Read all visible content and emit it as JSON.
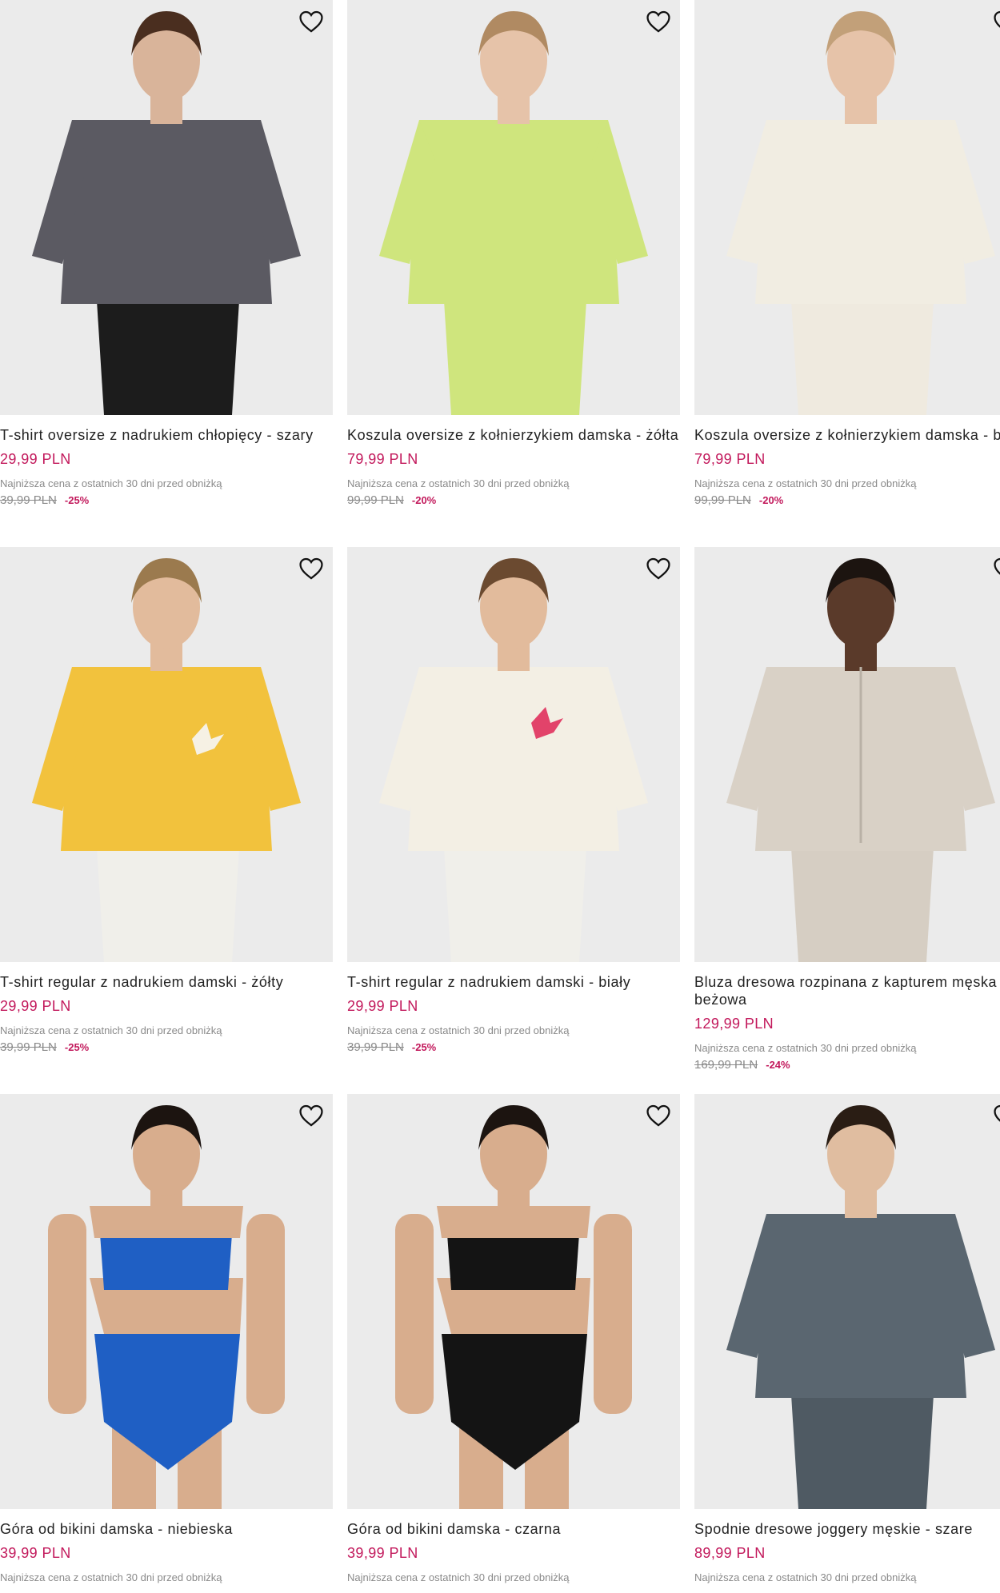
{
  "accent_price_color": "#c2185b",
  "icons": {
    "wishlist": "heart-outline-icon"
  },
  "products": [
    {
      "title": "T-shirt oversize z nadrukiem chłopięcy - szary",
      "price": "29,99 PLN",
      "lowest_label": "Najniższa cena z ostatnich 30 dni przed obniżką",
      "old_price": "39,99 PLN",
      "discount": "-25%",
      "image_colors": {
        "top": "#5b5a62",
        "bottom": "#1c1c1c",
        "skin": "#d9b49a",
        "hair": "#4a2e1f"
      }
    },
    {
      "title": "Koszula oversize z kołnierzykiem damska - żółta",
      "price": "79,99 PLN",
      "lowest_label": "Najniższa cena z ostatnich 30 dni przed obniżką",
      "old_price": "99,99 PLN",
      "discount": "-20%",
      "image_colors": {
        "top": "#cfe57d",
        "bottom": "#cfe57d",
        "skin": "#e6c3a9",
        "hair": "#b08a62"
      }
    },
    {
      "title": "Koszula oversize z kołnierzykiem damska - biała",
      "price": "79,99 PLN",
      "lowest_label": "Najniższa cena z ostatnich 30 dni przed obniżką",
      "old_price": "99,99 PLN",
      "discount": "-20%",
      "image_colors": {
        "top": "#f1ede2",
        "bottom": "#efeadf",
        "skin": "#e6c3a9",
        "hair": "#c2a079"
      }
    },
    {
      "title": "T-shirt regular z nadrukiem damski - żółty",
      "price": "29,99 PLN",
      "lowest_label": "Najniższa cena z ostatnich 30 dni przed obniżką",
      "old_price": "39,99 PLN",
      "discount": "-25%",
      "image_colors": {
        "top": "#f2c23d",
        "bottom": "#f0efea",
        "skin": "#e2bb9c",
        "hair": "#9b7a4e"
      }
    },
    {
      "title": "T-shirt regular z nadrukiem damski - biały",
      "price": "29,99 PLN",
      "lowest_label": "Najniższa cena z ostatnich 30 dni przed obniżką",
      "old_price": "39,99 PLN",
      "discount": "-25%",
      "image_colors": {
        "top": "#f3efe4",
        "bottom": "#f0efea",
        "skin": "#e2bb9c",
        "hair": "#6b4a30"
      }
    },
    {
      "title": "Bluza dresowa rozpinana z kapturem męska - beżowa",
      "price": "129,99 PLN",
      "lowest_label": "Najniższa cena z ostatnich 30 dni przed obniżką",
      "old_price": "169,99 PLN",
      "discount": "-24%",
      "image_colors": {
        "top": "#d9d1c6",
        "bottom": "#d6cec3",
        "skin": "#5a3a2a",
        "hair": "#1c1410"
      }
    },
    {
      "title": "Góra od bikini damska - niebieska",
      "price": "39,99 PLN",
      "lowest_label": "Najniższa cena z ostatnich 30 dni przed obniżką",
      "image_colors": {
        "top": "#1f5fc4",
        "bottom": "#1f5fc4",
        "skin": "#d8ad8d",
        "hair": "#1c1410"
      }
    },
    {
      "title": "Góra od bikini damska - czarna",
      "price": "39,99 PLN",
      "lowest_label": "Najniższa cena z ostatnich 30 dni przed obniżką",
      "image_colors": {
        "top": "#141414",
        "bottom": "#141414",
        "skin": "#d8ad8d",
        "hair": "#1c1410"
      }
    },
    {
      "title": "Spodnie dresowe joggery męskie - szare",
      "price": "89,99 PLN",
      "lowest_label": "Najniższa cena z ostatnich 30 dni przed obniżką",
      "image_colors": {
        "top": "#5a6670",
        "bottom": "#4f5a63",
        "skin": "#e0bda0",
        "hair": "#2a1d14"
      }
    }
  ]
}
